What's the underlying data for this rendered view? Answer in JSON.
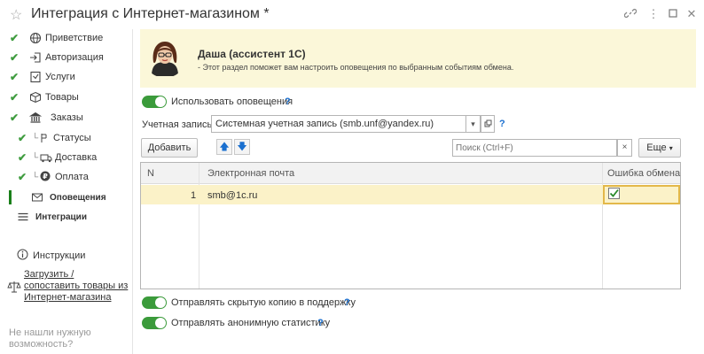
{
  "window": {
    "title": "Интеграция с Интернет-магазином *"
  },
  "sidebar": {
    "items": [
      {
        "label": "Приветствие",
        "icon": "globe-icon",
        "done": true
      },
      {
        "label": "Авторизация",
        "icon": "login-icon",
        "done": true
      },
      {
        "label": "Услуги",
        "icon": "services-icon",
        "done": true
      },
      {
        "label": "Товары",
        "icon": "box-icon",
        "done": true
      },
      {
        "label": "Заказы",
        "icon": "bank-icon",
        "done": true
      },
      {
        "label": "Статусы",
        "icon": "status-icon",
        "done": true
      },
      {
        "label": "Доставка",
        "icon": "delivery-icon",
        "done": true
      },
      {
        "label": "Оплата",
        "icon": "payment-icon",
        "done": true
      },
      {
        "label": "Оповещения",
        "icon": "envelope-icon",
        "active": true
      },
      {
        "label": "Интеграции",
        "icon": "menu-icon"
      }
    ],
    "instructions": "Инструкции",
    "upload_link": [
      "Загрузить /",
      "сопоставить товары из",
      "Интернет-магазина"
    ],
    "not_found": [
      "Не нашли нужную",
      "возможность?"
    ]
  },
  "assistant": {
    "name": "Даша (ассистент 1С)",
    "text": "- Этот раздел поможет вам  настроить оповещения по выбранным событиям обмена."
  },
  "notifications": {
    "use_label": "Использовать оповещения",
    "help": "?"
  },
  "account": {
    "label": "Учетная запись:",
    "value": "Системная учетная запись (smb.unf@yandex.ru)",
    "help": "?"
  },
  "toolbar": {
    "add_label": "Добавить",
    "search_placeholder": "Поиск (Ctrl+F)",
    "clear": "×",
    "more_label": "Еще"
  },
  "table": {
    "columns": [
      "N",
      "Электронная почта",
      "Ошибка обмена"
    ],
    "rows": [
      {
        "n": "1",
        "email": "smb@1c.ru",
        "error": true
      }
    ]
  },
  "options": {
    "hidden_copy": "Отправлять скрытую копию в поддержку",
    "anon_stats": "Отправлять анонимную статистику",
    "help": "?"
  },
  "colors": {
    "accent": "#3b9b3b",
    "banner_bg": "#fbf7d9",
    "selected_row": "#fbf2c8",
    "link_blue": "#1a6fcf"
  }
}
